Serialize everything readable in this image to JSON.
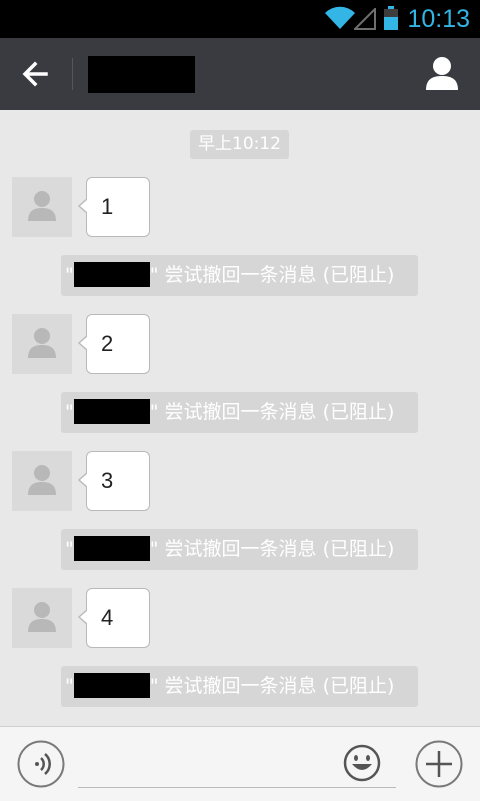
{
  "status_bar": {
    "time": "10:13",
    "accent_color": "#33b5e5"
  },
  "header": {
    "back_icon": "arrow-left-icon",
    "title": "",
    "profile_icon": "person-icon",
    "background": "#3a3b40"
  },
  "chat": {
    "time_divider": "早上10:12",
    "messages": [
      {
        "text": "1",
        "notice": "尝试撤回一条消息 (已阻止)"
      },
      {
        "text": "2",
        "notice": "尝试撤回一条消息 (已阻止)"
      },
      {
        "text": "3",
        "notice": "尝试撤回一条消息 (已阻止)"
      },
      {
        "text": "4",
        "notice": "尝试撤回一条消息 (已阻止)"
      }
    ]
  },
  "input_bar": {
    "voice_icon": "voice-icon",
    "emoji_icon": "smiley-icon",
    "plus_icon": "plus-icon",
    "placeholder": ""
  }
}
